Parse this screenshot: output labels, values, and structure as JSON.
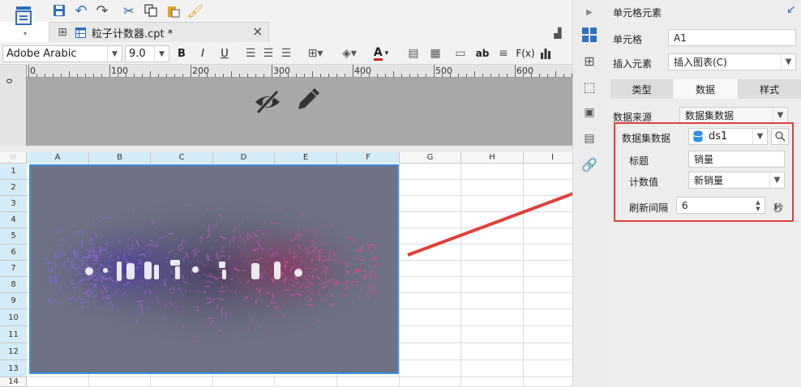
{
  "toolbar": {
    "font_name": "Adobe Arabic",
    "font_size": "9.0",
    "bold": "B",
    "italic": "I",
    "underline": "U",
    "text_style": "A",
    "ab": "ab",
    "fx": "F(x)"
  },
  "tab": {
    "title": "粒子计数器.cpt *",
    "close": "×"
  },
  "ruler": {
    "marks": [
      "0",
      "100",
      "200",
      "300",
      "400",
      "500",
      "600"
    ]
  },
  "sheet": {
    "columns": [
      "A",
      "B",
      "C",
      "D",
      "E",
      "F",
      "G",
      "H",
      "I"
    ],
    "rows": [
      "1",
      "2",
      "3",
      "4",
      "5",
      "6",
      "7",
      "8",
      "9",
      "10",
      "11",
      "12",
      "13",
      "14"
    ],
    "corner": "⁝⁝⁝"
  },
  "panel": {
    "title": "单元格元素",
    "cell_label": "单元格",
    "cell_value": "A1",
    "insert_label": "插入元素",
    "insert_value": "插入图表(C)",
    "tabs": [
      "类型",
      "数据",
      "样式"
    ],
    "source_label": "数据来源",
    "source_value": "数据集数据",
    "dataset_label": "数据集数据",
    "dataset_value": "ds1",
    "title_label": "标题",
    "title_value": "销量",
    "count_label": "计数值",
    "count_value": "新销量",
    "refresh_label": "刷新间隔",
    "refresh_value": "6",
    "refresh_unit": "秒"
  },
  "colors": {
    "highlight": "#e0413a",
    "accent": "#2f6fbf",
    "selected_header": "#d5ebf8"
  }
}
